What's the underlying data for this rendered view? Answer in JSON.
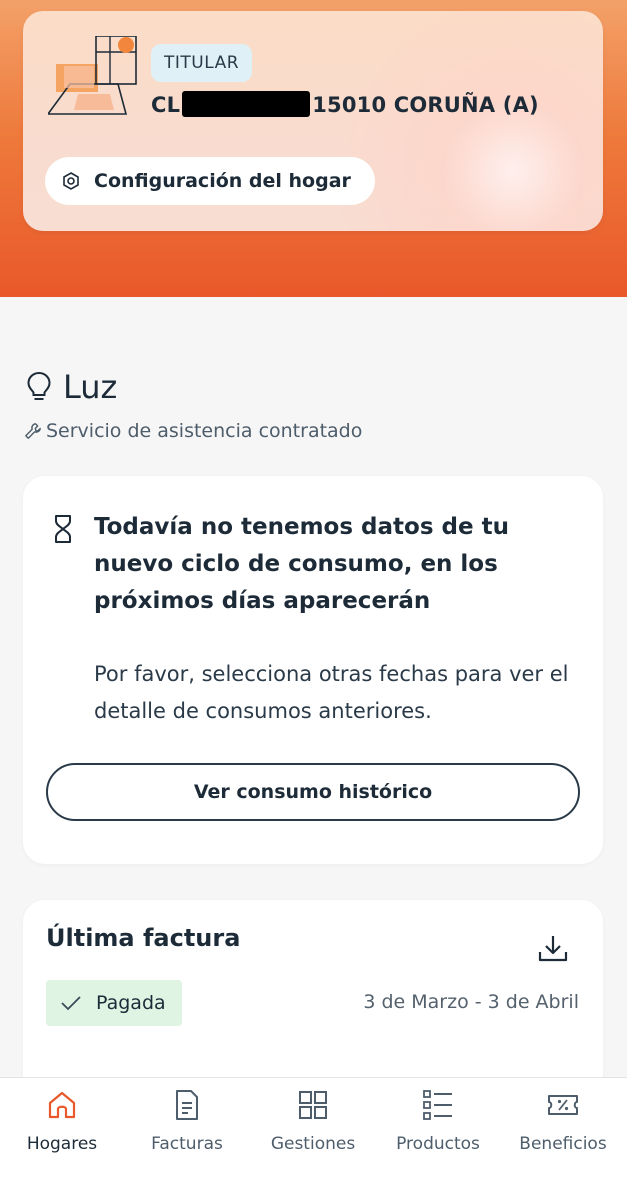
{
  "home": {
    "badge": "TITULAR",
    "address_start": "CL",
    "address_end": "15010 CORUÑA (A)",
    "config_label": "Configuración del hogar"
  },
  "luz": {
    "title": "Luz",
    "service": "Servicio de asistencia contratado"
  },
  "info_card": {
    "title": "Todavía no tenemos datos de tu nuevo ciclo de consumo, en los próximos días aparecerán",
    "text": "Por favor, selecciona otras fechas para ver el detalle de consumos anteriores.",
    "button": "Ver consumo histórico"
  },
  "bill_card": {
    "title": "Última factura",
    "status": "Pagada",
    "period": "3 de Marzo - 3 de Abril"
  },
  "nav": {
    "items": [
      {
        "label": "Hogares",
        "icon": "home-icon",
        "active": true
      },
      {
        "label": "Facturas",
        "icon": "invoice-icon",
        "active": false
      },
      {
        "label": "Gestiones",
        "icon": "grid-icon",
        "active": false
      },
      {
        "label": "Productos",
        "icon": "list-icon",
        "active": false
      },
      {
        "label": "Beneficios",
        "icon": "discount-ticket-icon",
        "active": false
      }
    ]
  },
  "colors": {
    "accent": "#e9582a",
    "text": "#1d2b38",
    "paid_bg": "#dff4e3",
    "badge_bg": "#dff1f7"
  }
}
